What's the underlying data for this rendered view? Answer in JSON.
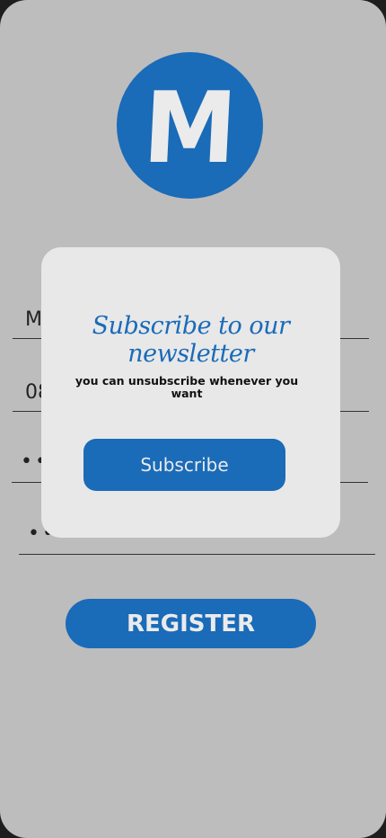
{
  "app": {
    "logo_letter": "M"
  },
  "form": {
    "name_value": "M",
    "phone_value": "08",
    "password_mask": "••",
    "confirm_password_mask": "••",
    "register_label": "REGISTER"
  },
  "modal": {
    "title": "Subscribe to our newsletter",
    "message": "you can unsubscribe whenever you want",
    "subscribe_label": "Subscribe"
  },
  "colors": {
    "background": "#bdbdbd",
    "accent": "#1a6bb8",
    "modal_background": "#e8e8e9",
    "button_text": "#ebebeb"
  }
}
